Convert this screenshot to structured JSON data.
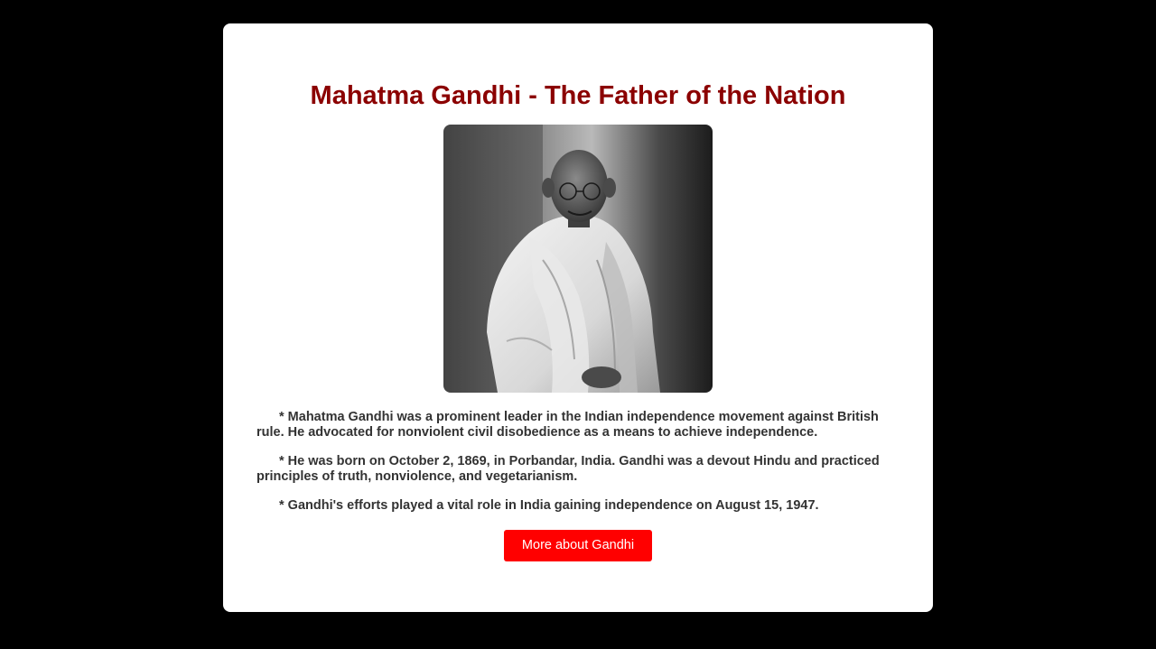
{
  "header": {
    "title": "Mahatma Gandhi - The Father of the Nation"
  },
  "portrait": {
    "alt": "Portrait of Mahatma Gandhi"
  },
  "content": {
    "paragraphs": [
      "* Mahatma Gandhi was a prominent leader in the Indian independence movement against British rule. He advocated for nonviolent civil disobedience as a means to achieve independence.",
      "* He was born on October 2, 1869, in Porbandar, India. Gandhi was a devout Hindu and practiced principles of truth, nonviolence, and vegetarianism.",
      "* Gandhi's efforts played a vital role in India gaining independence on August 15, 1947."
    ]
  },
  "actions": {
    "more_label": "More about Gandhi"
  },
  "colors": {
    "page_background": "#000000",
    "card_background": "#ffffff",
    "title_color": "#8b0000",
    "text_color": "#333333",
    "button_background": "#ff0000",
    "button_text": "#ffffff"
  }
}
